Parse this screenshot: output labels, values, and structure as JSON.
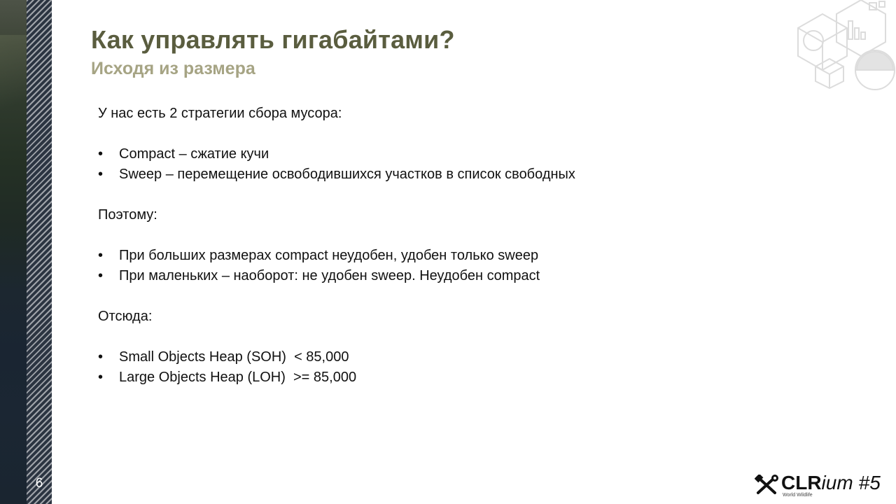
{
  "slide": {
    "number": "6",
    "title": "Как управлять гигабайтами?",
    "subtitle": "Исходя из размера"
  },
  "content": {
    "intro": "У нас есть 2 стратегии сбора мусора:",
    "strategies": [
      "Compact – сжатие кучи",
      "Sweep – перемещение освободившихся участков в список свободных"
    ],
    "therefore_label": "Поэтому:",
    "therefore_items": [
      "При больших размерах compact неудобен, удобен только sweep",
      "При маленьких – наоборот: не удобен sweep. Неудобен compact"
    ],
    "hence_label": "Отсюда:",
    "hence_items": [
      "Small Objects Heap (SOH)  < 85,000",
      "Large Objects Heap (LOH)  >= 85,000"
    ],
    "bullet": "•"
  },
  "logo": {
    "clr": "CLR",
    "ium": "ium",
    "edition": "#5",
    "tagline": "World Wildlife"
  },
  "colors": {
    "title": "#5a5d3f",
    "subtitle": "#a6a484",
    "sidebar": "#2b3441"
  }
}
